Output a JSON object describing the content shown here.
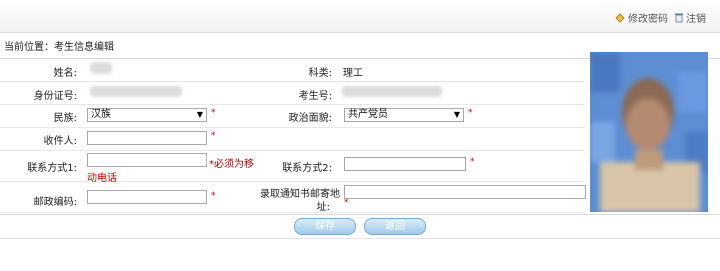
{
  "header": {
    "change_password": "修改密码",
    "logout": "注销"
  },
  "breadcrumb": "当前位置：考生信息编辑",
  "form": {
    "name_label": "姓名:",
    "subject_label": "科类:",
    "subject_value": "理工",
    "id_label": "身份证号:",
    "exam_no_label": "考生号:",
    "ethnicity_label": "民族:",
    "ethnicity_value": "汉族",
    "political_label": "政治面貌:",
    "political_value": "共产党员",
    "recipient_label": "收件人:",
    "contact1_label": "联系方式1:",
    "contact1_hint_a": "*必须为移",
    "contact1_hint_b": "动电话",
    "contact2_label": "联系方式2:",
    "postcode_label": "邮政编码:",
    "address_label_a": "录取通知书邮寄地",
    "address_label_b": "址:",
    "required_mark": "*"
  },
  "buttons": {
    "save": "保存",
    "back": "返回"
  },
  "colors": {
    "required": "#cc0000",
    "button_gradient_top": "#d9eefc",
    "button_gradient_bottom": "#9fc9ea"
  }
}
